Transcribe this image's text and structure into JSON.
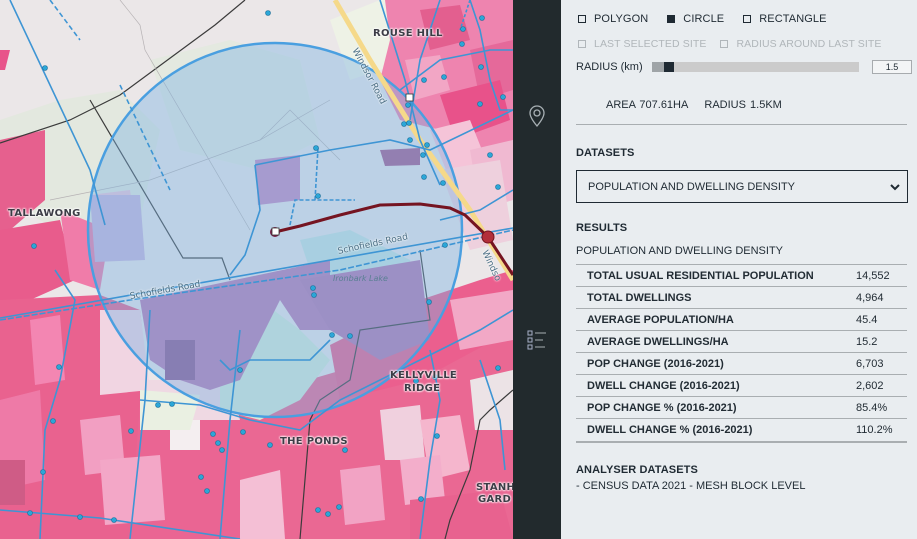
{
  "map": {
    "labels": {
      "rouse_hill": "ROUSE HILL",
      "tallawong": "TALLAWONG",
      "kellyville_ridge_1": "KELLYVILLE",
      "kellyville_ridge_2": "RIDGE",
      "the_ponds": "THE PONDS",
      "stanhope_1": "STANH",
      "stanhope_2": "GARD",
      "windsor_road": "Windsor Road",
      "windsor_road_2": "Windso",
      "schofields_road": "Schofields Road",
      "schofields_road_2": "Schofields Road",
      "ironbark_lake": "Ironbark Lake"
    },
    "colors": {
      "circle_fill": "#7db3e3",
      "circle_stroke": "#4a9fe0",
      "route": "#7a1420",
      "density_high": "#e8507e",
      "density_mid": "#f07aa6",
      "density_low": "#f1c1d7",
      "overlay_purple": "#9a5d98"
    }
  },
  "rail": {
    "pin_icon": "map-pin-icon",
    "layers_icon": "list-icon"
  },
  "panel": {
    "shape_options": [
      {
        "label": "POLYGON",
        "selected": false
      },
      {
        "label": "CIRCLE",
        "selected": true
      },
      {
        "label": "RECTANGLE",
        "selected": false
      }
    ],
    "site_options": [
      {
        "label": "LAST SELECTED SITE",
        "disabled": true
      },
      {
        "label": "RADIUS AROUND LAST SITE",
        "disabled": true
      }
    ],
    "radius": {
      "label": "RADIUS (km)",
      "value": "1.5",
      "fraction": 0.06
    },
    "area_text": "AREA 707.61HA",
    "radius_text": "RADIUS 1.5KM",
    "datasets": {
      "title": "DATASETS",
      "selected": "POPULATION AND DWELLING DENSITY"
    },
    "results": {
      "title": "RESULTS",
      "subtitle": "POPULATION AND DWELLING DENSITY",
      "rows": [
        {
          "label": "TOTAL USUAL RESIDENTIAL POPULATION",
          "value": "14,552"
        },
        {
          "label": "TOTAL DWELLINGS",
          "value": "4,964"
        },
        {
          "label": "AVERAGE POPULATION/HA",
          "value": "45.4"
        },
        {
          "label": "AVERAGE DWELLINGS/HA",
          "value": "15.2"
        },
        {
          "label": "POP CHANGE (2016-2021)",
          "value": "6,703"
        },
        {
          "label": "DWELL CHANGE (2016-2021)",
          "value": "2,602"
        },
        {
          "label": "POP CHANGE % (2016-2021)",
          "value": "85.4%"
        },
        {
          "label": "DWELL CHANGE % (2016-2021)",
          "value": "110.2%"
        }
      ]
    },
    "analyser": {
      "title": "ANALYSER DATASETS",
      "items": [
        "- CENSUS DATA 2021 - MESH BLOCK LEVEL"
      ]
    }
  }
}
